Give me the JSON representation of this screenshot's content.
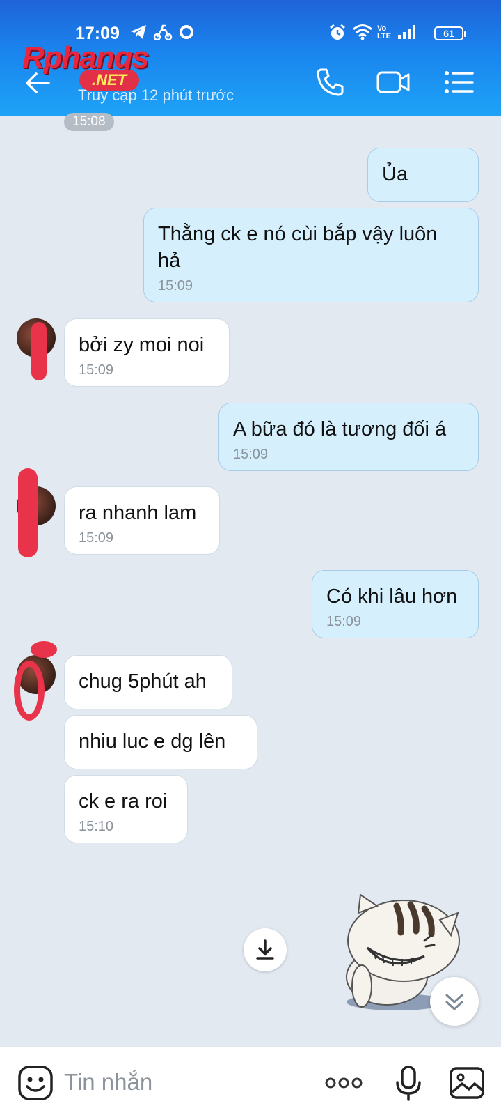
{
  "status_bar": {
    "time": "17:09",
    "battery": "61",
    "network": "Vo LTE"
  },
  "header": {
    "contact_name": "",
    "last_seen": "Truy cập 12 phút trước",
    "watermark": "Rphangs",
    "watermark_sub": ".NET"
  },
  "chat": {
    "top_time_chip": "15:08",
    "messages": [
      {
        "dir": "out",
        "text": "Ủa",
        "time": ""
      },
      {
        "dir": "out",
        "text": "Thằng ck e nó cùi bắp vậy luôn hả",
        "time": "15:09"
      },
      {
        "dir": "in",
        "text": "bởi zy moi noi",
        "time": "15:09"
      },
      {
        "dir": "out",
        "text": "A bữa đó là tương đối á",
        "time": "15:09"
      },
      {
        "dir": "in",
        "text": "ra nhanh lam",
        "time": "15:09"
      },
      {
        "dir": "out",
        "text": "Có khi lâu hơn",
        "time": "15:09"
      },
      {
        "dir": "in",
        "text": "chug 5phút ah",
        "time": ""
      },
      {
        "dir": "in",
        "text": "nhiu luc e dg lên",
        "time": ""
      },
      {
        "dir": "in",
        "text": "ck e ra roi",
        "time": "15:10"
      }
    ]
  },
  "input": {
    "placeholder": "Tin nhắn"
  },
  "colors": {
    "header_top": "#1f63d8",
    "header_bottom": "#1ea3f7",
    "outgoing_bubble": "#d5effd",
    "chat_bg": "#e2e9f1"
  },
  "icons": [
    "back-arrow-icon",
    "phone-icon",
    "video-call-icon",
    "menu-list-icon",
    "emoji-icon",
    "more-icon",
    "microphone-icon",
    "image-icon",
    "download-icon",
    "chevron-down-double-icon"
  ]
}
